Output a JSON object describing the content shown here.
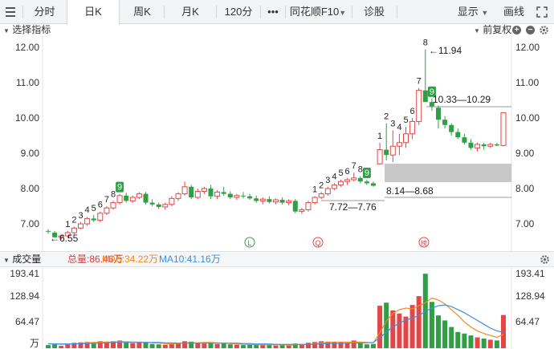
{
  "tabs": [
    {
      "label": "分时",
      "active": false
    },
    {
      "label": "日K",
      "active": true
    },
    {
      "label": "周K",
      "active": false
    },
    {
      "label": "月K",
      "active": false
    },
    {
      "label": "120分",
      "active": false
    },
    {
      "label": "•••",
      "active": false
    },
    {
      "label": "同花顺F10",
      "active": false
    },
    {
      "label": "诊股",
      "active": false
    }
  ],
  "toolbar": {
    "display_label": "显示",
    "draw_label": "画线"
  },
  "indicator": {
    "select_label": "选择指标",
    "adjust_label": "前复权"
  },
  "price_axis": {
    "left_labels": [
      "12.00",
      "11.00",
      "10.00",
      "9.00",
      "8.00",
      "7.00"
    ],
    "right_labels": [
      "12.00",
      "11.00",
      "10.00",
      "9.00",
      "8.00",
      "7.00"
    ]
  },
  "annotations": {
    "high": "←11.94",
    "low": "←6.55",
    "upper_zone": "10.33—10.29",
    "gap_zone": "8.14—8.68",
    "lower_zone": "7.72—7.76",
    "event_marker_1": "L",
    "event_marker_2": "Q",
    "event_marker_3": "榜"
  },
  "volume": {
    "title": "成交量",
    "total": "总量:86.46万",
    "ma5": "MA5:34.22万",
    "ma10": "MA10:41.16万",
    "left_labels": [
      "193.41",
      "128.94",
      "64.47",
      "万"
    ],
    "right_labels": [
      "193.41",
      "128.94",
      "64.47"
    ]
  },
  "colors": {
    "up": "#e64545",
    "down": "#2f9e44",
    "ma5": "#f08a24",
    "ma10": "#3a8ee6",
    "total": "#e03a3a"
  },
  "chart_data": {
    "type": "candlestick",
    "ylim": [
      6.45,
      12.3
    ],
    "volume_ylim": [
      0,
      225
    ],
    "candles": [
      {
        "o": 6.8,
        "h": 6.85,
        "l": 6.72,
        "c": 6.78,
        "v": 8
      },
      {
        "o": 6.75,
        "h": 6.8,
        "l": 6.6,
        "c": 6.62,
        "v": 10
      },
      {
        "o": 6.62,
        "h": 6.7,
        "l": 6.55,
        "c": 6.66,
        "v": 6
      },
      {
        "o": 6.66,
        "h": 6.8,
        "l": 6.6,
        "c": 6.75,
        "v": 12
      },
      {
        "o": 6.75,
        "h": 6.92,
        "l": 6.7,
        "c": 6.88,
        "v": 14
      },
      {
        "o": 6.88,
        "h": 7.05,
        "l": 6.85,
        "c": 7.0,
        "v": 15
      },
      {
        "o": 7.0,
        "h": 7.2,
        "l": 6.95,
        "c": 7.15,
        "v": 16
      },
      {
        "o": 7.15,
        "h": 7.25,
        "l": 7.05,
        "c": 7.1,
        "v": 12
      },
      {
        "o": 7.1,
        "h": 7.35,
        "l": 7.05,
        "c": 7.3,
        "v": 18
      },
      {
        "o": 7.3,
        "h": 7.5,
        "l": 7.25,
        "c": 7.45,
        "v": 17
      },
      {
        "o": 7.45,
        "h": 7.65,
        "l": 7.4,
        "c": 7.6,
        "v": 18
      },
      {
        "o": 7.6,
        "h": 7.85,
        "l": 7.55,
        "c": 7.8,
        "v": 20
      },
      {
        "o": 7.8,
        "h": 7.88,
        "l": 7.6,
        "c": 7.65,
        "v": 15
      },
      {
        "o": 7.65,
        "h": 7.8,
        "l": 7.6,
        "c": 7.75,
        "v": 13
      },
      {
        "o": 7.75,
        "h": 7.9,
        "l": 7.7,
        "c": 7.85,
        "v": 14
      },
      {
        "o": 7.85,
        "h": 7.9,
        "l": 7.55,
        "c": 7.6,
        "v": 16
      },
      {
        "o": 7.6,
        "h": 7.7,
        "l": 7.5,
        "c": 7.55,
        "v": 11
      },
      {
        "o": 7.55,
        "h": 7.6,
        "l": 7.42,
        "c": 7.48,
        "v": 10
      },
      {
        "o": 7.48,
        "h": 7.6,
        "l": 7.4,
        "c": 7.55,
        "v": 9
      },
      {
        "o": 7.55,
        "h": 7.78,
        "l": 7.5,
        "c": 7.72,
        "v": 12
      },
      {
        "o": 7.72,
        "h": 7.9,
        "l": 7.65,
        "c": 7.85,
        "v": 13
      },
      {
        "o": 7.85,
        "h": 8.2,
        "l": 7.8,
        "c": 8.05,
        "v": 18
      },
      {
        "o": 8.05,
        "h": 8.1,
        "l": 7.7,
        "c": 7.75,
        "v": 17
      },
      {
        "o": 7.75,
        "h": 8.0,
        "l": 7.7,
        "c": 7.92,
        "v": 13
      },
      {
        "o": 7.92,
        "h": 8.05,
        "l": 7.85,
        "c": 8.0,
        "v": 12
      },
      {
        "o": 8.0,
        "h": 8.1,
        "l": 7.7,
        "c": 7.78,
        "v": 14
      },
      {
        "o": 7.78,
        "h": 7.95,
        "l": 7.7,
        "c": 7.9,
        "v": 11
      },
      {
        "o": 7.9,
        "h": 8.05,
        "l": 7.8,
        "c": 7.85,
        "v": 12
      },
      {
        "o": 7.85,
        "h": 7.92,
        "l": 7.7,
        "c": 7.75,
        "v": 10
      },
      {
        "o": 7.75,
        "h": 7.85,
        "l": 7.68,
        "c": 7.8,
        "v": 9
      },
      {
        "o": 7.8,
        "h": 7.9,
        "l": 7.72,
        "c": 7.78,
        "v": 8
      },
      {
        "o": 7.78,
        "h": 7.85,
        "l": 7.68,
        "c": 7.72,
        "v": 9
      },
      {
        "o": 7.72,
        "h": 7.8,
        "l": 7.6,
        "c": 7.65,
        "v": 10
      },
      {
        "o": 7.65,
        "h": 7.75,
        "l": 7.55,
        "c": 7.7,
        "v": 8
      },
      {
        "o": 7.7,
        "h": 7.78,
        "l": 7.58,
        "c": 7.62,
        "v": 9
      },
      {
        "o": 7.62,
        "h": 7.72,
        "l": 7.55,
        "c": 7.68,
        "v": 7
      },
      {
        "o": 7.68,
        "h": 7.75,
        "l": 7.55,
        "c": 7.6,
        "v": 8
      },
      {
        "o": 7.6,
        "h": 7.7,
        "l": 7.52,
        "c": 7.65,
        "v": 7
      },
      {
        "o": 7.65,
        "h": 7.7,
        "l": 7.3,
        "c": 7.35,
        "v": 12
      },
      {
        "o": 7.35,
        "h": 7.45,
        "l": 7.28,
        "c": 7.4,
        "v": 10
      },
      {
        "o": 7.4,
        "h": 7.65,
        "l": 7.35,
        "c": 7.6,
        "v": 14
      },
      {
        "o": 7.6,
        "h": 7.78,
        "l": 7.55,
        "c": 7.75,
        "v": 16
      },
      {
        "o": 7.75,
        "h": 7.9,
        "l": 7.7,
        "c": 7.85,
        "v": 18
      },
      {
        "o": 7.85,
        "h": 8.05,
        "l": 7.8,
        "c": 8.0,
        "v": 17
      },
      {
        "o": 8.0,
        "h": 8.15,
        "l": 7.95,
        "c": 8.1,
        "v": 16
      },
      {
        "o": 8.1,
        "h": 8.25,
        "l": 8.05,
        "c": 8.2,
        "v": 15
      },
      {
        "o": 8.2,
        "h": 8.3,
        "l": 8.1,
        "c": 8.25,
        "v": 14
      },
      {
        "o": 8.25,
        "h": 8.45,
        "l": 8.2,
        "c": 8.3,
        "v": 20
      },
      {
        "o": 8.3,
        "h": 8.35,
        "l": 8.15,
        "c": 8.2,
        "v": 13
      },
      {
        "o": 8.2,
        "h": 8.25,
        "l": 8.1,
        "c": 8.15,
        "v": 10
      },
      {
        "o": 8.15,
        "h": 8.2,
        "l": 8.05,
        "c": 8.08,
        "v": 11
      },
      {
        "o": 8.7,
        "h": 9.3,
        "l": 8.68,
        "c": 9.1,
        "v": 110
      },
      {
        "o": 9.1,
        "h": 9.85,
        "l": 8.8,
        "c": 8.95,
        "v": 118
      },
      {
        "o": 8.95,
        "h": 9.65,
        "l": 8.75,
        "c": 9.2,
        "v": 98
      },
      {
        "o": 9.2,
        "h": 9.55,
        "l": 8.95,
        "c": 9.3,
        "v": 90
      },
      {
        "o": 9.3,
        "h": 9.75,
        "l": 9.15,
        "c": 9.55,
        "v": 82
      },
      {
        "o": 9.55,
        "h": 10.0,
        "l": 9.4,
        "c": 9.9,
        "v": 112
      },
      {
        "o": 9.9,
        "h": 10.85,
        "l": 9.8,
        "c": 10.78,
        "v": 135
      },
      {
        "o": 10.78,
        "h": 11.94,
        "l": 10.6,
        "c": 10.45,
        "v": 193
      },
      {
        "o": 10.45,
        "h": 10.55,
        "l": 10.2,
        "c": 10.33,
        "v": 120
      },
      {
        "o": 10.29,
        "h": 10.35,
        "l": 9.7,
        "c": 9.95,
        "v": 85
      },
      {
        "o": 9.95,
        "h": 10.05,
        "l": 9.7,
        "c": 9.8,
        "v": 72
      },
      {
        "o": 9.8,
        "h": 9.85,
        "l": 9.5,
        "c": 9.6,
        "v": 55
      },
      {
        "o": 9.6,
        "h": 9.7,
        "l": 9.4,
        "c": 9.45,
        "v": 42
      },
      {
        "o": 9.45,
        "h": 9.55,
        "l": 9.25,
        "c": 9.3,
        "v": 38
      },
      {
        "o": 9.3,
        "h": 9.4,
        "l": 9.1,
        "c": 9.15,
        "v": 33
      },
      {
        "o": 9.15,
        "h": 9.3,
        "l": 9.05,
        "c": 9.25,
        "v": 28
      },
      {
        "o": 9.25,
        "h": 9.3,
        "l": 9.1,
        "c": 9.2,
        "v": 25
      },
      {
        "o": 9.2,
        "h": 9.3,
        "l": 9.15,
        "c": 9.25,
        "v": 22
      },
      {
        "o": 9.25,
        "h": 9.3,
        "l": 9.2,
        "c": 9.22,
        "v": 20
      },
      {
        "o": 9.22,
        "h": 10.15,
        "l": 9.2,
        "c": 10.15,
        "v": 86
      }
    ],
    "markers": [
      {
        "i": 3,
        "t": "1"
      },
      {
        "i": 4,
        "t": "2"
      },
      {
        "i": 5,
        "t": "3"
      },
      {
        "i": 6,
        "t": "4"
      },
      {
        "i": 7,
        "t": "5"
      },
      {
        "i": 8,
        "t": "6"
      },
      {
        "i": 9,
        "t": "7"
      },
      {
        "i": 10,
        "t": "8"
      },
      {
        "i": 11,
        "t": "9",
        "box": true
      },
      {
        "i": 41,
        "t": "1"
      },
      {
        "i": 42,
        "t": "2"
      },
      {
        "i": 43,
        "t": "3"
      },
      {
        "i": 44,
        "t": "4"
      },
      {
        "i": 45,
        "t": "5"
      },
      {
        "i": 46,
        "t": "6"
      },
      {
        "i": 47,
        "t": "7"
      },
      {
        "i": 48,
        "t": "8"
      },
      {
        "i": 49,
        "t": "9",
        "box": true
      },
      {
        "i": 51,
        "t": "1"
      },
      {
        "i": 52,
        "t": "2"
      },
      {
        "i": 53,
        "t": "3"
      },
      {
        "i": 54,
        "t": "4"
      },
      {
        "i": 55,
        "t": "5"
      },
      {
        "i": 56,
        "t": "6"
      },
      {
        "i": 57,
        "t": "7"
      },
      {
        "i": 58,
        "t": "8"
      },
      {
        "i": 59,
        "t": "9",
        "box": true
      }
    ],
    "ma5": [
      12,
      11,
      10,
      10,
      11,
      12,
      14,
      15,
      15,
      16,
      16,
      17,
      17,
      16,
      16,
      15,
      14,
      13,
      12,
      11,
      12,
      13,
      14,
      14,
      15,
      15,
      14,
      13,
      12,
      11,
      10,
      10,
      9,
      9,
      9,
      9,
      9,
      8,
      9,
      9,
      10,
      12,
      14,
      15,
      16,
      16,
      16,
      16,
      16,
      15,
      14,
      40,
      70,
      90,
      100,
      104,
      102,
      110,
      118,
      130,
      125,
      115,
      100,
      85,
      68,
      55,
      45,
      38,
      33,
      28,
      36
    ],
    "ma10": [
      11,
      11,
      11,
      11,
      11,
      12,
      12,
      13,
      13,
      14,
      15,
      15,
      15,
      15,
      15,
      15,
      15,
      15,
      14,
      14,
      13,
      13,
      13,
      13,
      13,
      13,
      13,
      13,
      13,
      13,
      12,
      12,
      11,
      11,
      11,
      10,
      10,
      10,
      10,
      10,
      10,
      10,
      11,
      12,
      12,
      12,
      13,
      13,
      14,
      14,
      15,
      27,
      42,
      55,
      65,
      73,
      78,
      85,
      95,
      104,
      110,
      112,
      108,
      100,
      92,
      82,
      72,
      62,
      52,
      45,
      41
    ]
  }
}
